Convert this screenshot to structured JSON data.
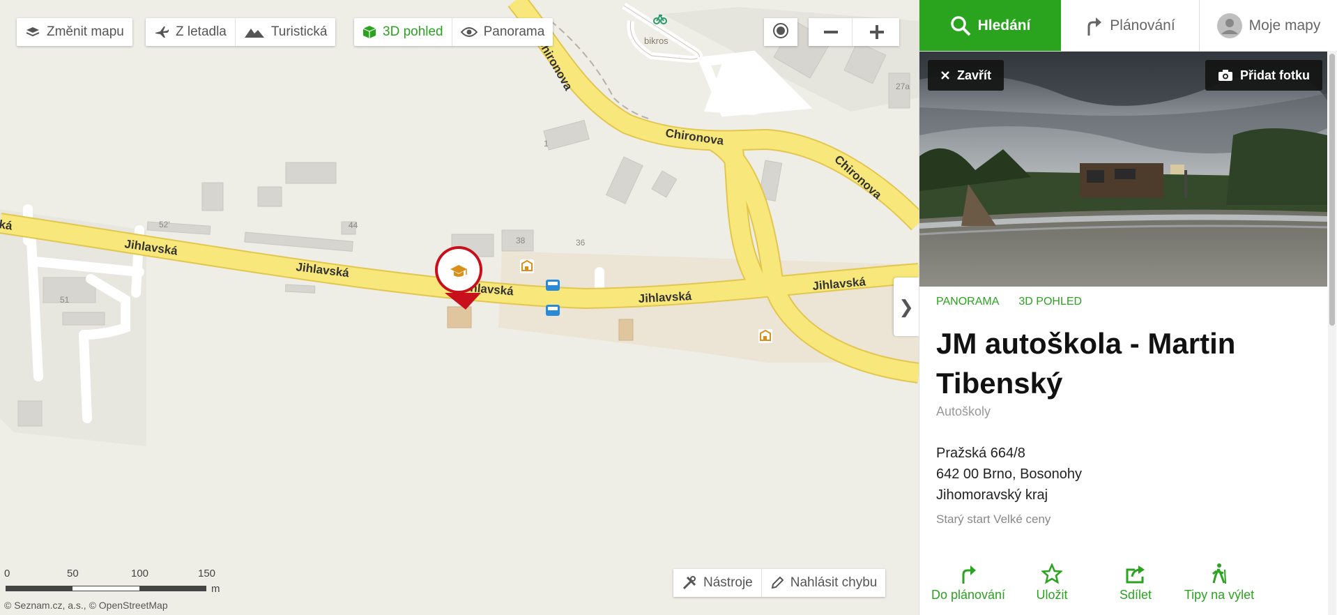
{
  "map": {
    "toolbar": {
      "change_map": "Změnit mapu",
      "aerial": "Z letadla",
      "tourist": "Turistická",
      "view3d": "3D pohled",
      "panorama": "Panorama"
    },
    "roads": {
      "jihlavska": "Jihlavská",
      "jihlavska_partial_left": "ká",
      "jihlavska_partial_pin": "hlavská",
      "chironova": "Chironova"
    },
    "poi_label": "bikros",
    "house_numbers": [
      "27a",
      "1",
      "52'",
      "44",
      "38",
      "36",
      "51"
    ],
    "bottom_tools": {
      "tools": "Nástroje",
      "report": "Nahlásit chybu"
    },
    "scale": {
      "labels": [
        "0",
        "50",
        "100",
        "150"
      ],
      "unit": "m"
    },
    "attribution": "© Seznam.cz, a.s., © OpenStreetMap",
    "collapse_glyph": "❯",
    "colors": {
      "accent": "#2aa31f",
      "road": "#f8e77a",
      "road_edge": "#e6c94f",
      "pin": "#c8101c"
    }
  },
  "panel": {
    "tabs": {
      "search": "Hledání",
      "planning": "Plánování",
      "mymaps": "Moje mapy"
    },
    "close_label": "Zavřít",
    "add_photo_label": "Přidat fotku",
    "links": {
      "panorama": "PANORAMA",
      "view3d": "3D POHLED"
    },
    "title": "JM autoškola - Martin Tibenský",
    "category": "Autoškoly",
    "address": {
      "line1": "Pražská 664/8",
      "line2": "642 00  Brno, Bosonohy",
      "line3": "Jihomoravský kraj"
    },
    "note": "Starý start Velké ceny",
    "actions": {
      "plan": "Do plánování",
      "save": "Uložit",
      "share": "Sdílet",
      "trips": "Tipy na výlet"
    }
  }
}
